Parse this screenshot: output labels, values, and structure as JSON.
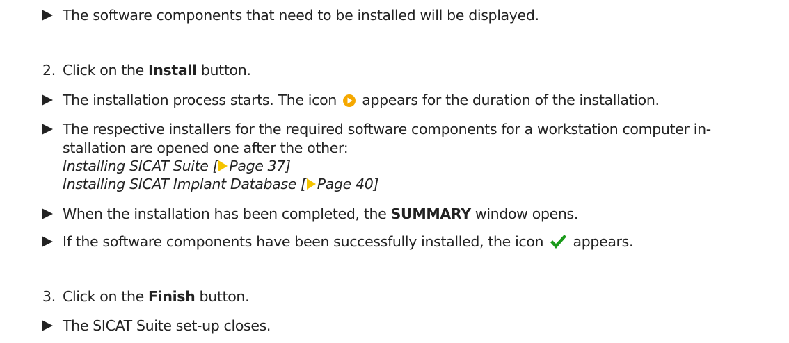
{
  "result_components_displayed": "The software components that need to be installed will be displayed.",
  "step2": {
    "number": "2.",
    "text_before": "Click on the ",
    "button": "Install",
    "text_after": " button."
  },
  "result_process_starts": {
    "before": "The installation process starts. The icon ",
    "after": " appears for the duration of the installation.",
    "icon": "play-progress-icon",
    "icon_color": "#f5a800"
  },
  "result_installers": {
    "line1": "The respective installers for the required software components for a workstation computer in-",
    "line2": "stallation are opened one after the other:",
    "links": [
      {
        "text": "Installing SICAT Suite [",
        "page": "Page 37",
        "close": "]"
      },
      {
        "text": "Installing SICAT Implant Database [",
        "page": "Page 40",
        "close": "]"
      }
    ]
  },
  "result_summary": {
    "before": "When the installation has been completed, the ",
    "window": "SUMMARY",
    "after": " window opens."
  },
  "result_success": {
    "before": "If the software components have been successfully installed, the icon ",
    "after": " appears.",
    "icon": "green-checkmark-icon",
    "icon_color": "#1a9a1a"
  },
  "step3": {
    "number": "3.",
    "text_before": "Click on the ",
    "button": "Finish",
    "text_after": " button."
  },
  "result_setup_closes": "The SICAT Suite set-up closes."
}
